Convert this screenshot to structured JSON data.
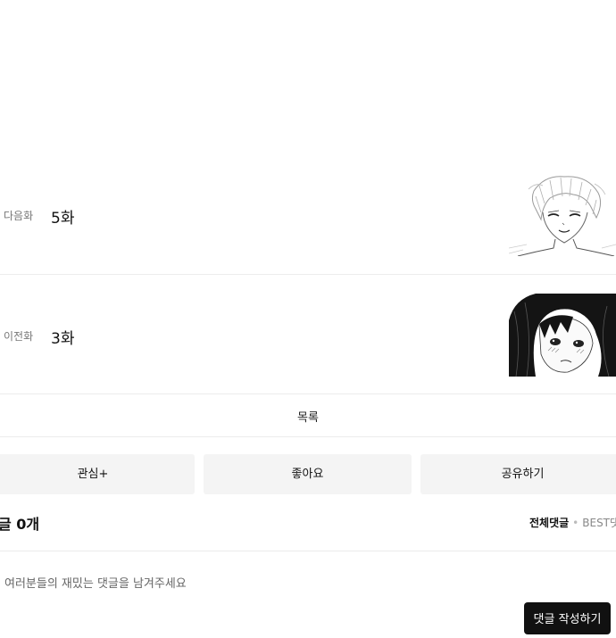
{
  "next_episode": {
    "kind": "다음화",
    "title": "5화"
  },
  "prev_episode": {
    "kind": "이전화",
    "title": "3화"
  },
  "list_button": "목록",
  "actions": {
    "interest": "관심+",
    "like": "좋아요",
    "share": "공유하기"
  },
  "comments": {
    "count_label": "글 0개",
    "sort_all": "전체댓글",
    "sort_best": "BEST댓",
    "placeholder": "여러분들의 재밌는 댓글을 남겨주세요",
    "write_button": "댓글 작성하기"
  }
}
